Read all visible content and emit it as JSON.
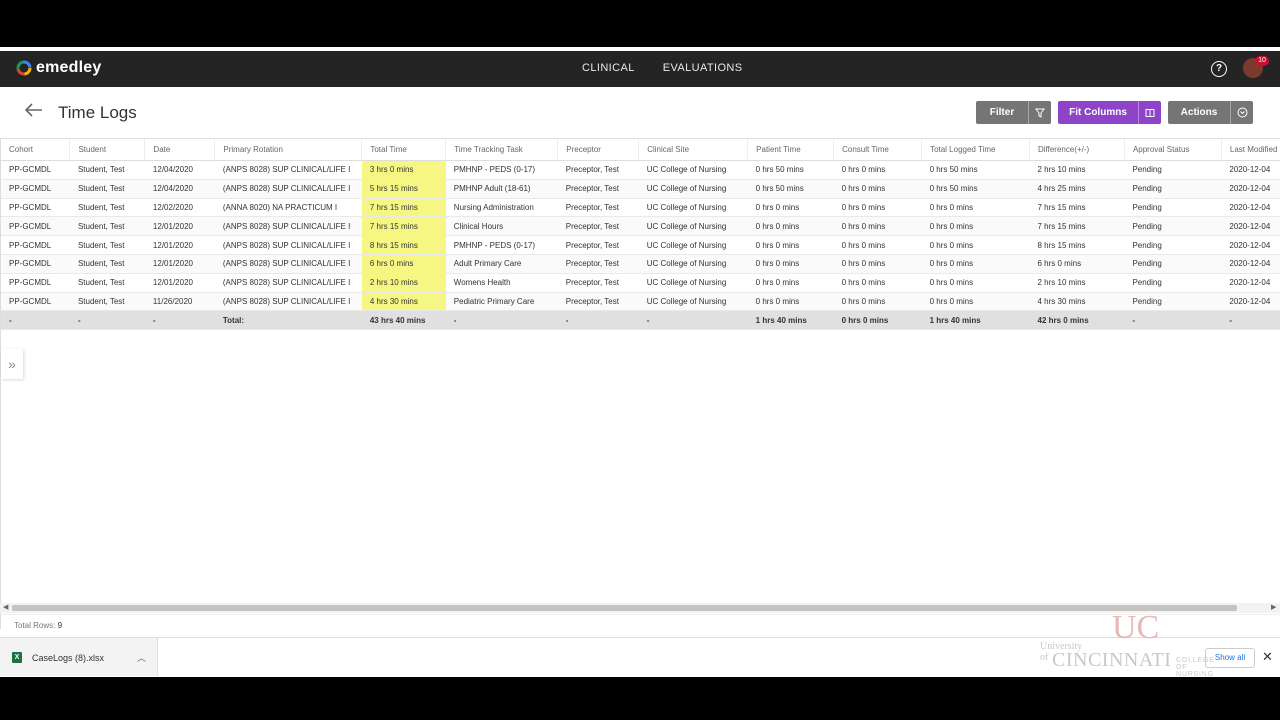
{
  "nav": {
    "brand": "emedley",
    "links": [
      "CLINICAL",
      "EVALUATIONS"
    ],
    "notification_count": "10"
  },
  "page": {
    "title": "Time Logs"
  },
  "toolbar": {
    "filter_label": "Filter",
    "fit_columns_label": "Fit Columns",
    "actions_label": "Actions"
  },
  "table": {
    "columns": [
      "Cohort",
      "Student",
      "Date",
      "Primary Rotation",
      "Total Time",
      "Time Tracking Task",
      "Preceptor",
      "Clinical Site",
      "Patient Time",
      "Consult Time",
      "Total Logged Time",
      "Difference(+/-)",
      "Approval Status",
      "Last Modified"
    ],
    "rows": [
      [
        "PP-GCMDL",
        "Student, Test",
        "12/04/2020",
        "(ANPS 8028) SUP CLINICAL/LIFE I",
        "3 hrs 0 mins",
        "PMHNP - PEDS (0-17)",
        "Preceptor, Test",
        "UC College of Nursing",
        "0 hrs 50 mins",
        "0 hrs 0 mins",
        "0 hrs 50 mins",
        "2 hrs 10 mins",
        "Pending",
        "2020-12-04"
      ],
      [
        "PP-GCMDL",
        "Student, Test",
        "12/04/2020",
        "(ANPS 8028) SUP CLINICAL/LIFE I",
        "5 hrs 15 mins",
        "PMHNP Adult (18-61)",
        "Preceptor, Test",
        "UC College of Nursing",
        "0 hrs 50 mins",
        "0 hrs 0 mins",
        "0 hrs 50 mins",
        "4 hrs 25 mins",
        "Pending",
        "2020-12-04"
      ],
      [
        "PP-GCMDL",
        "Student, Test",
        "12/02/2020",
        "(ANNA 8020) NA PRACTICUM I",
        "7 hrs 15 mins",
        "Nursing Administration",
        "Preceptor, Test",
        "UC College of Nursing",
        "0 hrs 0 mins",
        "0 hrs 0 mins",
        "0 hrs 0 mins",
        "7 hrs 15 mins",
        "Pending",
        "2020-12-04"
      ],
      [
        "PP-GCMDL",
        "Student, Test",
        "12/01/2020",
        "(ANPS 8028) SUP CLINICAL/LIFE I",
        "7 hrs 15 mins",
        "Clinical Hours",
        "Preceptor, Test",
        "UC College of Nursing",
        "0 hrs 0 mins",
        "0 hrs 0 mins",
        "0 hrs 0 mins",
        "7 hrs 15 mins",
        "Pending",
        "2020-12-04"
      ],
      [
        "PP-GCMDL",
        "Student, Test",
        "12/01/2020",
        "(ANPS 8028) SUP CLINICAL/LIFE I",
        "8 hrs 15 mins",
        "PMHNP - PEDS (0-17)",
        "Preceptor, Test",
        "UC College of Nursing",
        "0 hrs 0 mins",
        "0 hrs 0 mins",
        "0 hrs 0 mins",
        "8 hrs 15 mins",
        "Pending",
        "2020-12-04"
      ],
      [
        "PP-GCMDL",
        "Student, Test",
        "12/01/2020",
        "(ANPS 8028) SUP CLINICAL/LIFE I",
        "6 hrs 0 mins",
        "Adult Primary Care",
        "Preceptor, Test",
        "UC College of Nursing",
        "0 hrs 0 mins",
        "0 hrs 0 mins",
        "0 hrs 0 mins",
        "6 hrs 0 mins",
        "Pending",
        "2020-12-04"
      ],
      [
        "PP-GCMDL",
        "Student, Test",
        "12/01/2020",
        "(ANPS 8028) SUP CLINICAL/LIFE I",
        "2 hrs 10 mins",
        "Womens Health",
        "Preceptor, Test",
        "UC College of Nursing",
        "0 hrs 0 mins",
        "0 hrs 0 mins",
        "0 hrs 0 mins",
        "2 hrs 10 mins",
        "Pending",
        "2020-12-04"
      ],
      [
        "PP-GCMDL",
        "Student, Test",
        "11/26/2020",
        "(ANPS 8028) SUP CLINICAL/LIFE I",
        "4 hrs 30 mins",
        "Pediatric Primary Care",
        "Preceptor, Test",
        "UC College of Nursing",
        "0 hrs 0 mins",
        "0 hrs 0 mins",
        "0 hrs 0 mins",
        "4 hrs 30 mins",
        "Pending",
        "2020-12-04"
      ]
    ],
    "total_row": [
      "-",
      "-",
      "-",
      "Total:",
      "43 hrs 40 mins",
      "-",
      "-",
      "-",
      "1 hrs 40 mins",
      "0 hrs 0 mins",
      "1 hrs 40 mins",
      "42 hrs 0 mins",
      "-",
      "-"
    ]
  },
  "footer": {
    "total_rows_label": "Total Rows:",
    "total_rows_value": "9"
  },
  "download_bar": {
    "file_name": "CaseLogs (8).xlsx",
    "show_all_label": "Show all"
  },
  "watermark": {
    "university": "University of",
    "name": "CINCINNATI",
    "college": "COLLEGE OF NURSING"
  },
  "colors": {
    "nav_bg": "#242424",
    "accent_purple": "#8e44c9",
    "button_gray": "#757575",
    "highlight_yellow": "#f6f783"
  }
}
